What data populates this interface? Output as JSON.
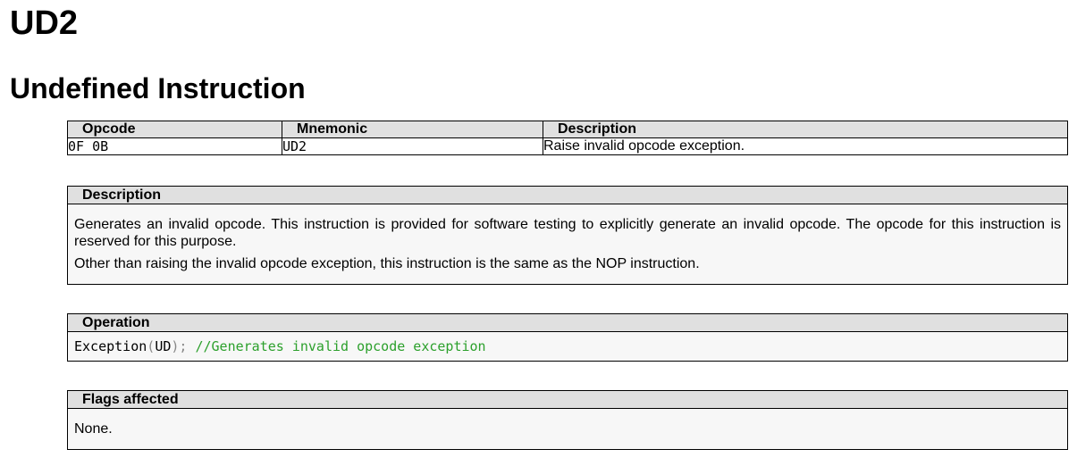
{
  "title": "UD2",
  "subtitle": "Undefined Instruction",
  "opcode_table": {
    "headers": [
      "Opcode",
      "Mnemonic",
      "Description"
    ],
    "rows": [
      {
        "opcode": "0F 0B",
        "mnemonic": "UD2",
        "description": "Raise invalid opcode exception."
      }
    ]
  },
  "description": {
    "heading": "Description",
    "paragraphs": [
      "Generates an invalid opcode. This instruction is provided for software testing to explicitly generate an invalid opcode. The opcode for this instruction is reserved for this purpose.",
      "Other than raising the invalid opcode exception, this instruction is the same as the NOP instruction."
    ]
  },
  "operation": {
    "heading": "Operation",
    "code": {
      "func": "Exception",
      "open_paren": "(",
      "arg": "UD",
      "close": ");",
      "comment": "//Generates invalid opcode exception"
    }
  },
  "flags": {
    "heading": "Flags affected",
    "text": "None."
  },
  "colors": {
    "header_bg": "#e0e0e0",
    "section_bg": "#f7f7f7",
    "code_comment": "#2ca02c",
    "code_punct": "#888888"
  }
}
